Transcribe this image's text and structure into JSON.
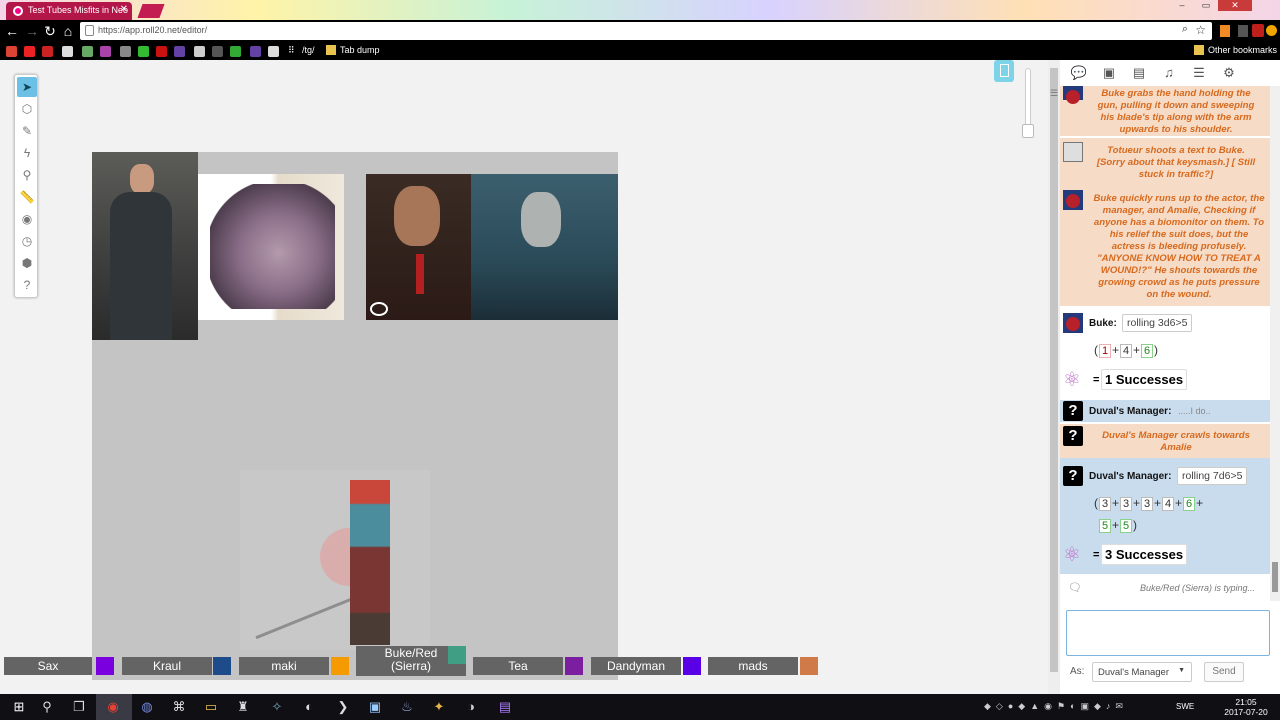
{
  "browser": {
    "tab_title": "Test Tubes Misfits in Neo",
    "url": "https://app.roll20.net/editor/",
    "bookmarks": [
      {
        "label": "/tg/"
      },
      {
        "label": "Tab dump"
      },
      {
        "label": "Other bookmarks"
      }
    ]
  },
  "nameplates": [
    {
      "label": "Sax",
      "color": "#7a00e0"
    },
    {
      "label": "Kraul",
      "color": "#1e4b8a"
    },
    {
      "label": "maki",
      "color": "#f59a00"
    },
    {
      "label": "Buke/Red\n(Sierra)",
      "color": "#3f9e84"
    },
    {
      "label": "Tea",
      "color": "#7b1ea0"
    },
    {
      "label": "Dandyman",
      "color": "#5a00e6"
    },
    {
      "label": "mads",
      "color": "#d07a4a"
    }
  ],
  "chat": {
    "msg1": "Buke grabs the hand holding the gun, pulling it down and sweeping his blade's tip along with the arm upwards to his shoulder.",
    "msg2": "Totueur shoots a text to Buke. [Sorry about that keysmash.] [ Still stuck in traffic?]",
    "msg3": "Buke quickly runs up to the actor, the manager, and Amalie, Checking if anyone has a biomonitor on them. To his relief the suit does, but the actress is bleeding profusely. \"ANYONE KNOW HOW TO TREAT A WOUND!?\" He shouts towards the growing crowd as he puts pressure on the wound.",
    "roll1": {
      "speaker": "Buke:",
      "formula": "rolling 3d6>5",
      "dice": [
        "1",
        "4",
        "6"
      ],
      "result": "1 Successes"
    },
    "gm_say": {
      "speaker": "Duval's Manager:",
      "text": ".....I do.."
    },
    "gm_emote": "Duval's Manager crawls towards Amalie",
    "roll2": {
      "speaker": "Duval's Manager:",
      "formula": "rolling 7d6>5",
      "dice": [
        "3",
        "3",
        "3",
        "4",
        "6",
        "5",
        "5"
      ],
      "result": "3 Successes"
    },
    "typing": "Buke/Red (Sierra) is typing...",
    "as_label": "As:",
    "as_value": "Duval's Manager",
    "send_label": "Send"
  },
  "taskbar": {
    "lang": "SWE",
    "time": "21:05",
    "date": "2017-07-20"
  }
}
